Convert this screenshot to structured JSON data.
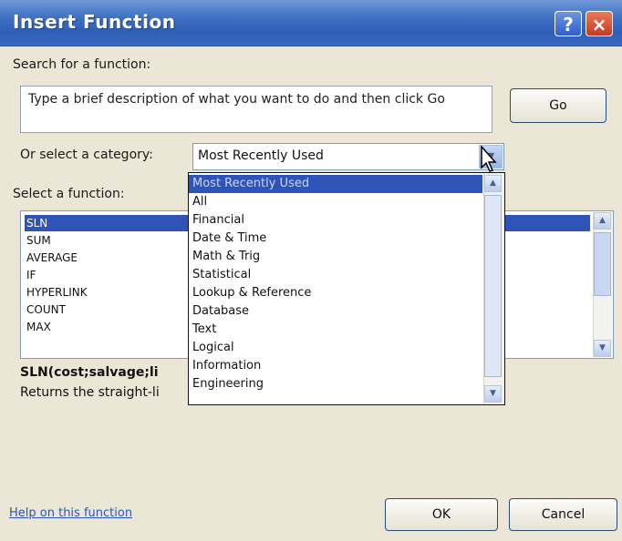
{
  "window": {
    "title": "Insert Function",
    "help_symbol": "?",
    "close_symbol": "×"
  },
  "search": {
    "label": "Search for a function:",
    "placeholder": "Type a brief description of what you want to do and then click Go",
    "go_label": "Go"
  },
  "category": {
    "label": "Or select a category:",
    "selected": "Most Recently Used",
    "options": [
      "Most Recently Used",
      "All",
      "Financial",
      "Date & Time",
      "Math & Trig",
      "Statistical",
      "Lookup & Reference",
      "Database",
      "Text",
      "Logical",
      "Information",
      "Engineering"
    ]
  },
  "functions": {
    "label": "Select a function:",
    "items": [
      "SLN",
      "SUM",
      "AVERAGE",
      "IF",
      "HYPERLINK",
      "COUNT",
      "MAX"
    ],
    "selected": "SLN"
  },
  "details": {
    "syntax": "SLN(cost;salvage;li",
    "description": "Returns the straight-li"
  },
  "footer": {
    "help_link": "Help on this function",
    "ok_label": "OK",
    "cancel_label": "Cancel"
  },
  "icons": {
    "scroll_up": "▲",
    "scroll_down": "▼",
    "combo_arrow": "▼"
  },
  "colors": {
    "titlebar": "#3d6fc3",
    "selection": "#2f53b6",
    "dialog_bg": "#ece6d6"
  }
}
